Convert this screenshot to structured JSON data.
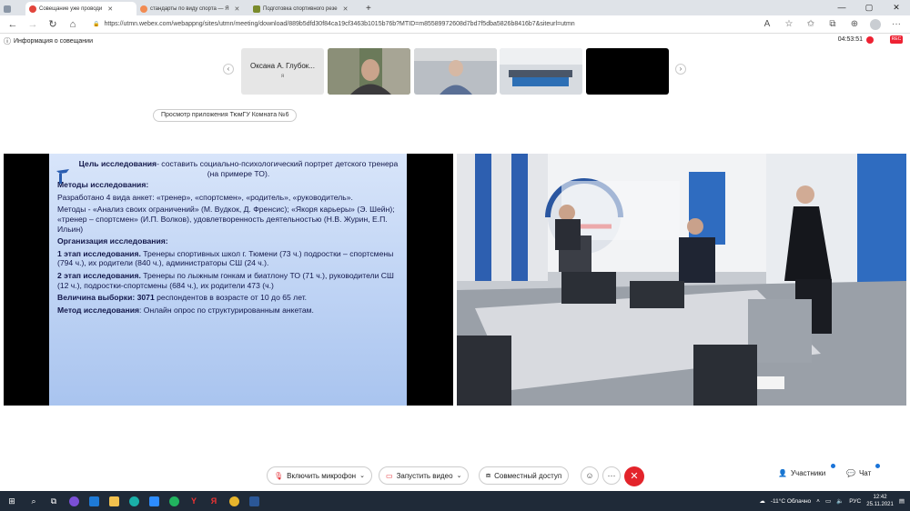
{
  "browser": {
    "tabs": [
      {
        "label": "Совещание уже проводи",
        "color": "#e2453c",
        "active": true
      },
      {
        "label": "стандарты по виду спорта — Я",
        "color": "#f28b52",
        "active": false
      },
      {
        "label": "Подготовка спортивного резе",
        "color": "#7a8b2c",
        "active": false
      }
    ],
    "new_tab": "+",
    "url": "https://utmn.webex.com/webappng/sites/utmn/meeting/download/889b5dfd30f84ca19cf3463b1015b76b?MTID=m85589972608d7bd7f5dba5826b8416b7&siteurl=utmn",
    "lock": "🔒"
  },
  "meeting": {
    "info_label": "Информация о совещании",
    "timer": "04:53:51",
    "rec": "REC",
    "thumbnails": [
      {
        "name": "Оксана А. Глубок...",
        "sub": "я"
      }
    ],
    "room_button": "Просмотр приложения ТюмГУ Комната №6"
  },
  "slide": {
    "goal_bold": "Цель исследования",
    "goal_text": "- составить социально-психологический портрет детского тренера (на примере ТО).",
    "methods_title": "Методы исследования:",
    "p1": "Разработано 4 вида анкет: «тренер», «спортсмен», «родитель», «руководитель».",
    "p2": "Методы - «Анализ своих ограничений» (М. Вудкок, Д. Френсис); «Якоря карьеры» (Э. Шейн); «тренер – спортсмен» (И.П. Волков), удовлетворенность деятельностью (Н.В. Журин, Е.П. Ильин)",
    "org_title": "Организация исследования:",
    "stage1_bold": "1 этап исследования.",
    "stage1_text": " Тренеры спортивных школ г. Тюмени (73 ч.) подростки – спортсмены (794 ч.), их родители (840 ч.), администраторы  СШ (24 ч.).",
    "stage2_bold": "2 этап исследования.",
    "stage2_text": " Тренеры по лыжным гонкам и биатлону ТО (71 ч.), руководители СШ (12 ч.), подростки-спортсмены (684 ч.), их родители 473 (ч.)",
    "sample_bold": "Величина выборки: 3071",
    "sample_text": " респондентов в возрасте от 10 до 65 лет.",
    "method_bold": "Метод исследования",
    "method_text": ": Онлайн опрос по структурированным анкетам."
  },
  "controls": {
    "mic": "Включить микрофон",
    "video": "Запустить видео",
    "share": "Совместный доступ",
    "participants": "Участники",
    "chat": "Чат"
  },
  "taskbar": {
    "weather": "-11°C  Облачно",
    "lang": "РУС",
    "time": "12:42",
    "date": "25.11.2021"
  }
}
